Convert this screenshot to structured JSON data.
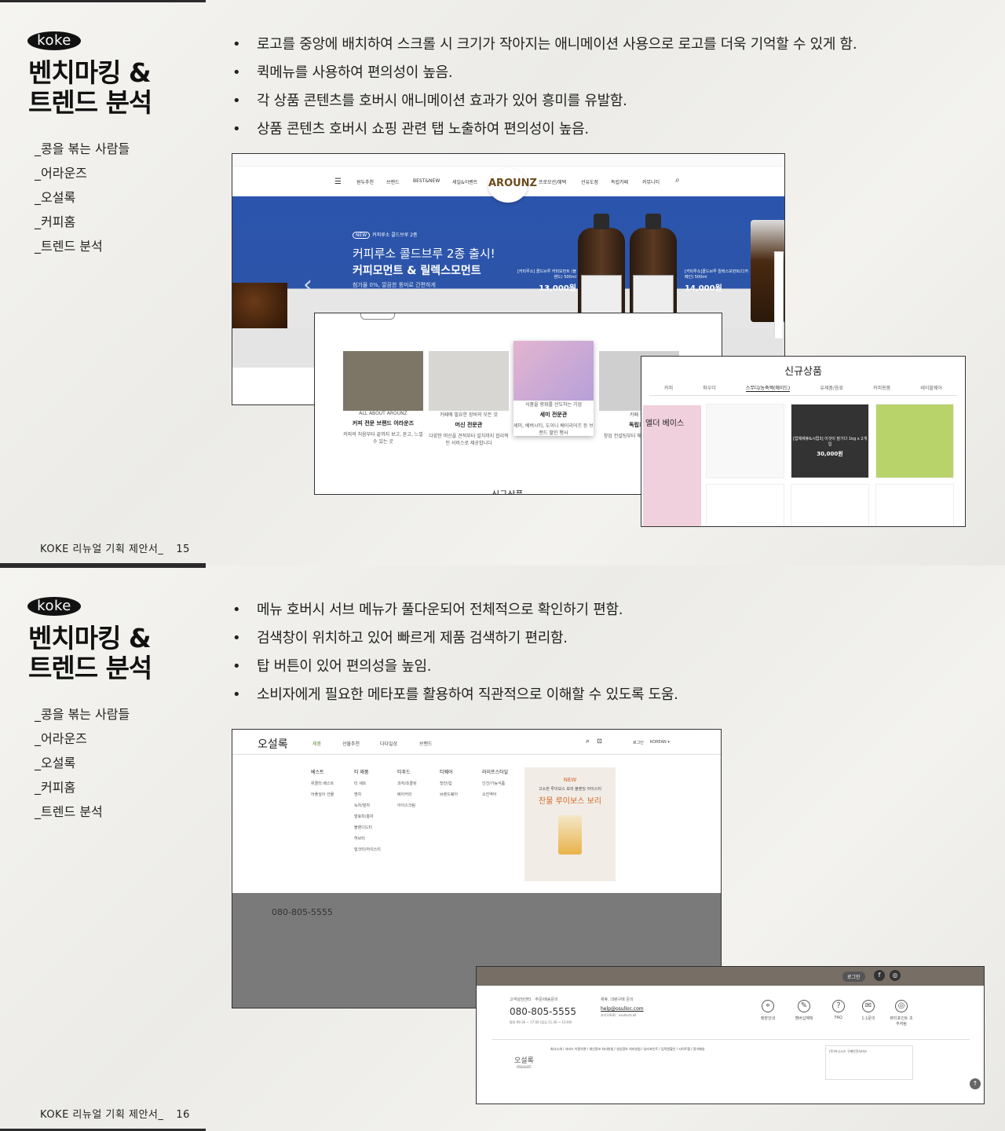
{
  "slides": [
    {
      "logo": "koke",
      "title_line1": "벤치마킹 &",
      "title_line2": "트렌드 분석",
      "nav": [
        "_콩을 볶는 사람들",
        "_어라운즈",
        "_오설록",
        "_커피홈",
        "_트렌드 분석"
      ],
      "footer": "KOKE 리뉴얼 기획 제안서_",
      "page": "15",
      "bullets": [
        "로고를 중앙에 배치하여 스크롤 시 크기가 작아지는 애니메이션 사용으로 로고를 더욱 기억할 수 있게 함.",
        "퀵메뉴를 사용하여 편의성이 높음.",
        "각 상품 콘텐츠를 호버시 애니메이션 효과가 있어 흥미를 유발함.",
        "상품 콘텐츠 호버시 쇼핑 관련 탭 노출하여 편의성이 높음."
      ]
    },
    {
      "logo": "koke",
      "title_line1": "벤치마킹 &",
      "title_line2": "트렌드 분석",
      "nav": [
        "_콩을 볶는 사람들",
        "_어라운즈",
        "_오설록",
        "_커피홈",
        "_트렌드 분석"
      ],
      "footer": "KOKE 리뉴얼 기획 제안서_",
      "page": "16",
      "bullets": [
        "메뉴 호버시 서브 메뉴가 풀다운되어 전체적으로 확인하기 편함.",
        "검색창이 위치하고 있어 빠르게 제품 검색하기 편리함.",
        "탑 버튼이 있어 편의성을 높임.",
        "소비자에게 필요한 메타포를 활용하여 직관적으로 이해할 수 있도록 도움."
      ]
    }
  ],
  "arounz": {
    "menu_left": [
      "원두추천",
      "브랜드",
      "BEST&NEW",
      "세일&이벤트"
    ],
    "logo": "AROUNZ",
    "menu_right": [
      "프로모션/혜택",
      "선유도점",
      "독립카페",
      "커뮤니티"
    ],
    "banner_tag": "커피루소 콜드브루 2종",
    "banner_title": "커피루소 콜드브루 2종 출시!",
    "banner_sub": "커피모먼트 & 릴렉스모먼트",
    "banner_desc": "첨가물 0%, 깔끔한 풍미로 간편하게",
    "price_left_label": "[커피루소] 콜드브루 커피모먼트 (블렌드) 500ml",
    "price_left": "13,000원",
    "price_right_label": "[커피루소]콜드브루 릴렉스모먼트(디카페인) 500ml",
    "price_right": "14,000원",
    "cards": [
      {
        "kicker": "ALL ABOUT AROUNZ",
        "title": "커피 전문 브랜드 어라운즈",
        "desc": "커피의 처음부터 끝까지 보고, 듣고, 느낄 수 있는 곳"
      },
      {
        "kicker": "카페에 필요한 장비의 모든 것",
        "title": "머신 전문관",
        "desc": "다양한 머신을 견적부터 설치까지 합리적인 서비스로 제공합니다"
      },
      {
        "kicker": "식품을 향화를 선도하는 기업",
        "title": "세미 전문관",
        "desc": "세미, 베버시티, 도이니 베이리어즈 등 브랜드 할인 행사"
      },
      {
        "kicker": "카페 창업",
        "title": "독립카페",
        "desc": "창업 컨설팅부터 매장 운영 지원까지"
      }
    ],
    "new_label": "신규상품",
    "new_title": "신규상품",
    "new_tabs": [
      "커피",
      "파우더",
      "스무디/농축액(에이드)",
      "유제품/음료",
      "커피용품",
      "테이블웨어"
    ],
    "elder": "엘더 베이스",
    "promo": "[업체제휴&시럽3] 이것이 말기다 1kg x 2개입",
    "promo_price": "30,000원"
  },
  "osulloc": {
    "brand": "오설록",
    "gnav": [
      "제품",
      "선물추천",
      "다다일상",
      "브랜드"
    ],
    "login": "로그인",
    "lang": "KOREAN ▾",
    "cols": [
      {
        "head": "베스트",
        "items": [
          "위클리 베스트",
          "어플잎이 선물"
        ]
      },
      {
        "head": "티 제품",
        "items": [
          "티 세트",
          "명차",
          "녹차/말차",
          "발효차/홍차",
          "블렌디드티",
          "허브티",
          "밀크티/아이스티"
        ]
      },
      {
        "head": "티푸드",
        "items": [
          "과자/초콜릿",
          "베이커리",
          "아이스크림"
        ]
      },
      {
        "head": "티웨어",
        "items": [
          "찻잔/컵",
          "브랜드웨어"
        ]
      },
      {
        "head": "라이프스타일",
        "items": [
          "인건/가능식품",
          "소진역어"
        ]
      }
    ],
    "promo_new": "NEW",
    "promo_small": "고소한 루이보스 보리 블렌딩 아이스티",
    "promo_big": "찬물 루이보스 보리",
    "cs_label": "고객상담센터 · 주문/배송문의",
    "phone": "080-805-5555",
    "hours": "평일 09:30 ~ 17:00 (점심 11:30 ~ 13:00)",
    "email_label": "제휴, 대량구매 문의",
    "email": "help@osulloc.com",
    "kakao": "카카오톡ID : osulloctcall",
    "icons": [
      {
        "glyph": "⌖",
        "label": "매장안내"
      },
      {
        "glyph": "✎",
        "label": "멤버십혜택"
      },
      {
        "glyph": "?",
        "label": "FAQ"
      },
      {
        "glyph": "✉",
        "label": "1:1문의"
      },
      {
        "glyph": "◎",
        "label": "뷰티포인트 초추처림"
      }
    ],
    "footer_login": "로그인",
    "footer_logo": "오설록",
    "footer_sub": "OSULLOC",
    "footer_links": "회사소개 / 서비스 이용약관 / 개인정보 처리방침 / 영상정보 처리방침 / 뷰티포인트 / 임직원할인 / 사이트맵 / 정기배송",
    "footer_escrow": "(주)이니시스 구매안전서비스"
  }
}
